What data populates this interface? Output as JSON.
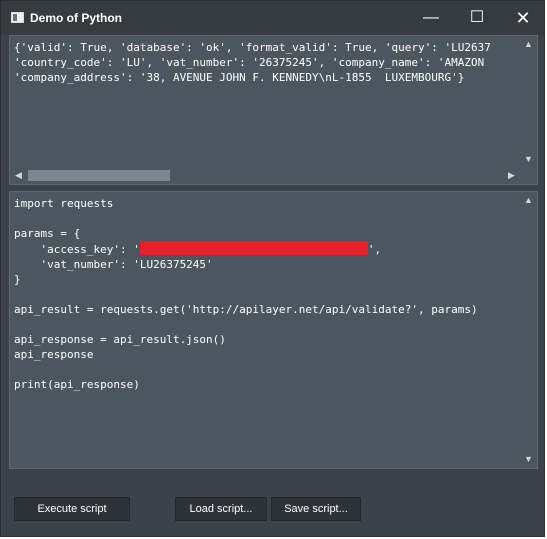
{
  "window": {
    "title": "Demo of Python",
    "minimize_glyph": "—",
    "maximize_glyph": "☐",
    "close_glyph": "✕"
  },
  "output": {
    "text": "{'valid': True, 'database': 'ok', 'format_valid': True, 'query': 'LU2637\n'country_code': 'LU', 'vat_number': '26375245', 'company_name': 'AMAZON\n'company_address': '38, AVENUE JOHN F. KENNEDY\\nL-1855  LUXEMBOURG'}"
  },
  "script": {
    "before_key": "import requests\n\nparams = {\n    'access_key': '",
    "after_key": "',\n    'vat_number': 'LU26375245'\n}\n\napi_result = requests.get('http://apilayer.net/api/validate?', params)\n\napi_response = api_result.json()\napi_response\n\nprint(api_response)"
  },
  "scroll": {
    "up": "▲",
    "down": "▼",
    "left": "◀",
    "right": "▶"
  },
  "buttons": {
    "execute": "Execute script",
    "load": "Load script...",
    "save": "Save script..."
  },
  "colors": {
    "background": "#3b4249",
    "pane": "#4c565f",
    "button": "#2d3338",
    "redaction": "#e8202a"
  }
}
